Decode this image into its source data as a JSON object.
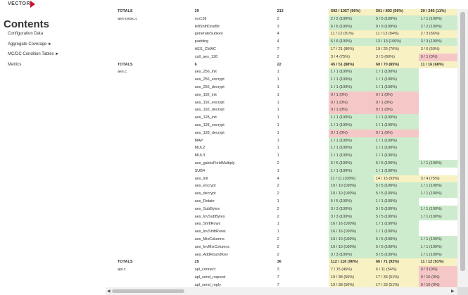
{
  "header": {
    "logo_text": "VECTOR",
    "logo_color": "#c8102e"
  },
  "sidebar": {
    "title": "Contents",
    "items": [
      {
        "label": "Configuration Data"
      },
      {
        "label": "Aggregate Coverage ►"
      },
      {
        "label": "MC/DC Condition Tables ►"
      },
      {
        "label": "Metrics"
      }
    ]
  },
  "table": {
    "rows": [
      {
        "file": "TOTALS",
        "fn": "29",
        "n": "213",
        "c1": "592 / 1057 (56%)",
        "c2": "501 / 892 (56%)",
        "c3": "20 / 246 (11%)",
        "s1": "yellow",
        "s2": "yellow",
        "s3": "yellow",
        "total": true
      },
      {
        "file": "aes-cmac.c",
        "fn": "xor128",
        "n": "2",
        "c1": "2 / 2 (100%)",
        "c2": "5 / 5 (100%)",
        "c3": "1 / 1 (100%)",
        "s1": "green",
        "s2": "green",
        "s3": "green"
      },
      {
        "file": "",
        "fn": "leftShiftOneBit",
        "n": "3",
        "c1": "6 / 6 (100%)",
        "c2": "9 / 9 (100%)",
        "c3": "2 / 2 (100%)",
        "s1": "green",
        "s2": "green",
        "s3": "green"
      },
      {
        "file": "",
        "fn": "generateSubkey",
        "n": "4",
        "c1": "11 / 12 (91%)",
        "c2": "11 / 13 (84%)",
        "c3": "2 / 3 (66%)",
        "s1": "yellow",
        "s2": "yellow",
        "s3": "yellow"
      },
      {
        "file": "",
        "fn": "padding",
        "n": "4",
        "c1": "6 / 6 (100%)",
        "c2": "13 / 13 (100%)",
        "c3": "3 / 3 (100%)",
        "s1": "green",
        "s2": "green",
        "s3": "green"
      },
      {
        "file": "",
        "fn": "AES_CMAC",
        "n": "7",
        "c1": "17 / 21 (80%)",
        "c2": "19 / 25 (76%)",
        "c3": "3 / 6 (50%)",
        "s1": "yellow",
        "s2": "yellow",
        "s3": "yellow"
      },
      {
        "file": "",
        "fn": "call_aes_128",
        "n": "2",
        "c1": "3 / 4 (75%)",
        "c2": "3 / 5 (60%)",
        "c3": "0 / 1 (0%)",
        "s1": "yellow",
        "s2": "yellow",
        "s3": "red"
      },
      {
        "file": "TOTALS",
        "fn": "6",
        "n": "22",
        "c1": "45 / 51 (88%)",
        "c2": "60 / 70 (85%)",
        "c3": "11 / 16 (68%)",
        "s1": "yellow",
        "s2": "yellow",
        "s3": "yellow",
        "total": true
      },
      {
        "file": "aes.c",
        "fn": "aes_256_init",
        "n": "1",
        "c1": "1 / 1 (100%)",
        "c2": "1 / 1 (100%)",
        "c3": "",
        "s1": "green",
        "s2": "green",
        "s3": ""
      },
      {
        "file": "",
        "fn": "aes_256_encrypt",
        "n": "1",
        "c1": "1 / 1 (100%)",
        "c2": "1 / 1 (100%)",
        "c3": "",
        "s1": "green",
        "s2": "green",
        "s3": ""
      },
      {
        "file": "",
        "fn": "aes_256_decrypt",
        "n": "1",
        "c1": "1 / 1 (100%)",
        "c2": "1 / 1 (100%)",
        "c3": "",
        "s1": "green",
        "s2": "green",
        "s3": ""
      },
      {
        "file": "",
        "fn": "aes_192_init",
        "n": "1",
        "c1": "0 / 1 (0%)",
        "c2": "0 / 1 (0%)",
        "c3": "",
        "s1": "red",
        "s2": "red",
        "s3": ""
      },
      {
        "file": "",
        "fn": "aes_192_encrypt",
        "n": "1",
        "c1": "0 / 1 (0%)",
        "c2": "0 / 1 (0%)",
        "c3": "",
        "s1": "red",
        "s2": "red",
        "s3": ""
      },
      {
        "file": "",
        "fn": "aes_192_decrypt",
        "n": "1",
        "c1": "0 / 1 (0%)",
        "c2": "0 / 1 (0%)",
        "c3": "",
        "s1": "red",
        "s2": "red",
        "s3": ""
      },
      {
        "file": "",
        "fn": "aes_128_init",
        "n": "1",
        "c1": "1 / 1 (100%)",
        "c2": "1 / 1 (100%)",
        "c3": "",
        "s1": "green",
        "s2": "green",
        "s3": ""
      },
      {
        "file": "",
        "fn": "aes_128_encrypt",
        "n": "1",
        "c1": "1 / 1 (100%)",
        "c2": "1 / 1 (100%)",
        "c3": "",
        "s1": "green",
        "s2": "green",
        "s3": ""
      },
      {
        "file": "",
        "fn": "aes_128_decrypt",
        "n": "1",
        "c1": "0 / 1 (0%)",
        "c2": "0 / 1 (0%)",
        "c3": "",
        "s1": "red",
        "s2": "red",
        "s3": ""
      },
      {
        "file": "",
        "fn": "MAP",
        "n": "1",
        "c1": "1 / 1 (100%)",
        "c2": "1 / 1 (100%)",
        "c3": "",
        "s1": "green",
        "s2": "green",
        "s3": ""
      },
      {
        "file": "",
        "fn": "MUL2",
        "n": "1",
        "c1": "1 / 1 (100%)",
        "c2": "1 / 1 (100%)",
        "c3": "",
        "s1": "green",
        "s2": "green",
        "s3": ""
      },
      {
        "file": "",
        "fn": "MUL3",
        "n": "1",
        "c1": "1 / 1 (100%)",
        "c2": "1 / 1 (100%)",
        "c3": "",
        "s1": "green",
        "s2": "green",
        "s3": ""
      },
      {
        "file": "",
        "fn": "aes_galoisFieldMultiply",
        "n": "2",
        "c1": "6 / 6 (100%)",
        "c2": "5 / 5 (100%)",
        "c3": "1 / 1 (100%)",
        "s1": "green",
        "s2": "green",
        "s3": "green"
      },
      {
        "file": "",
        "fn": "SUB4",
        "n": "1",
        "c1": "1 / 1 (100%)",
        "c2": "1 / 1 (100%)",
        "c3": "",
        "s1": "green",
        "s2": "green",
        "s3": ""
      },
      {
        "file": "",
        "fn": "aes_init",
        "n": "4",
        "c1": "11 / 11 (100%)",
        "c2": "14 / 15 (93%)",
        "c3": "3 / 4 (75%)",
        "s1": "green",
        "s2": "yellow",
        "s3": "yellow"
      },
      {
        "file": "",
        "fn": "aes_encrypt",
        "n": "2",
        "c1": "10 / 10 (100%)",
        "c2": "5 / 5 (100%)",
        "c3": "1 / 1 (100%)",
        "s1": "green",
        "s2": "green",
        "s3": "green"
      },
      {
        "file": "",
        "fn": "aes_decrypt",
        "n": "2",
        "c1": "10 / 10 (100%)",
        "c2": "5 / 5 (100%)",
        "c3": "1 / 1 (100%)",
        "s1": "green",
        "s2": "green",
        "s3": "green"
      },
      {
        "file": "",
        "fn": "aes_Rotate",
        "n": "1",
        "c1": "5 / 5 (100%)",
        "c2": "1 / 1 (100%)",
        "c3": "",
        "s1": "green",
        "s2": "green",
        "s3": ""
      },
      {
        "file": "",
        "fn": "aes_SubBytes",
        "n": "2",
        "c1": "3 / 3 (100%)",
        "c2": "5 / 5 (100%)",
        "c3": "1 / 1 (100%)",
        "s1": "green",
        "s2": "green",
        "s3": "green"
      },
      {
        "file": "",
        "fn": "aes_InvSubBytes",
        "n": "2",
        "c1": "3 / 3 (100%)",
        "c2": "5 / 5 (100%)",
        "c3": "1 / 1 (100%)",
        "s1": "green",
        "s2": "green",
        "s3": "green"
      },
      {
        "file": "",
        "fn": "aes_ShiftRows",
        "n": "1",
        "c1": "16 / 16 (100%)",
        "c2": "1 / 1 (100%)",
        "c3": "",
        "s1": "green",
        "s2": "green",
        "s3": ""
      },
      {
        "file": "",
        "fn": "aes_InvShiftRows",
        "n": "1",
        "c1": "16 / 16 (100%)",
        "c2": "1 / 1 (100%)",
        "c3": "",
        "s1": "green",
        "s2": "green",
        "s3": ""
      },
      {
        "file": "",
        "fn": "aes_MixColumns",
        "n": "2",
        "c1": "10 / 10 (100%)",
        "c2": "5 / 5 (100%)",
        "c3": "1 / 1 (100%)",
        "s1": "green",
        "s2": "green",
        "s3": "green"
      },
      {
        "file": "",
        "fn": "aes_InvMixColumns",
        "n": "2",
        "c1": "10 / 10 (100%)",
        "c2": "5 / 5 (100%)",
        "c3": "1 / 1 (100%)",
        "s1": "green",
        "s2": "green",
        "s3": "green"
      },
      {
        "file": "",
        "fn": "aes_AddRoundKey",
        "n": "2",
        "c1": "3 / 3 (100%)",
        "c2": "5 / 5 (100%)",
        "c3": "1 / 1 (100%)",
        "s1": "green",
        "s2": "green",
        "s3": "green"
      },
      {
        "file": "TOTALS",
        "fn": "25",
        "n": "36",
        "c1": "112 / 116 (96%)",
        "c2": "66 / 71 (92%)",
        "c3": "11 / 12 (91%)",
        "s1": "yellow",
        "s2": "yellow",
        "s3": "yellow",
        "total": true
      },
      {
        "file": "apl.c",
        "fn": "apl_connect",
        "n": "3",
        "c1": "7 / 15 (46%)",
        "c2": "6 / 11 (54%)",
        "c3": "0 / 3 (0%)",
        "s1": "yellow",
        "s2": "yellow",
        "s3": "red"
      },
      {
        "file": "",
        "fn": "apl_send_request",
        "n": "7",
        "c1": "19 / 38 (50%)",
        "c2": "17 / 33 (51%)",
        "c3": "0 / 10 (0%)",
        "s1": "yellow",
        "s2": "yellow",
        "s3": "red"
      },
      {
        "file": "",
        "fn": "apl_send_reply",
        "n": "7",
        "c1": "19 / 38 (50%)",
        "c2": "17 / 33 (51%)",
        "c3": "0 / 10 (0%)",
        "s1": "yellow",
        "s2": "yellow",
        "s3": "red"
      }
    ]
  },
  "scrollbars": {
    "left_arrow": "◀",
    "right_arrow": "▶"
  }
}
